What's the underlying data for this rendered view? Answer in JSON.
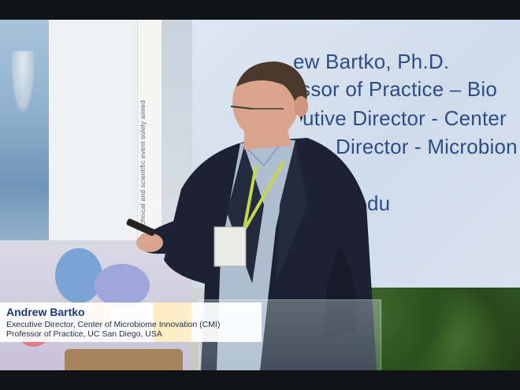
{
  "banner": {
    "vertical_text": "a technical and scientific event solely aimed"
  },
  "screen": {
    "lines": [
      "ew Bartko, Ph.D.",
      "ssor of Practice – Bio",
      "utive Director - Center",
      "Director - Microbion",
      "du"
    ]
  },
  "lower_third": {
    "name": "Andrew Bartko",
    "title_line1": "Executive Director, Center of Microbiome Innovation (CMI)",
    "title_line2": "Professor of Practice, UC San Diego, USA"
  },
  "colors": {
    "screen_text": "#2f4c87",
    "name_text": "#1a3a7a",
    "jacket": "#1c2233",
    "lanyard": "#c6d84a"
  }
}
